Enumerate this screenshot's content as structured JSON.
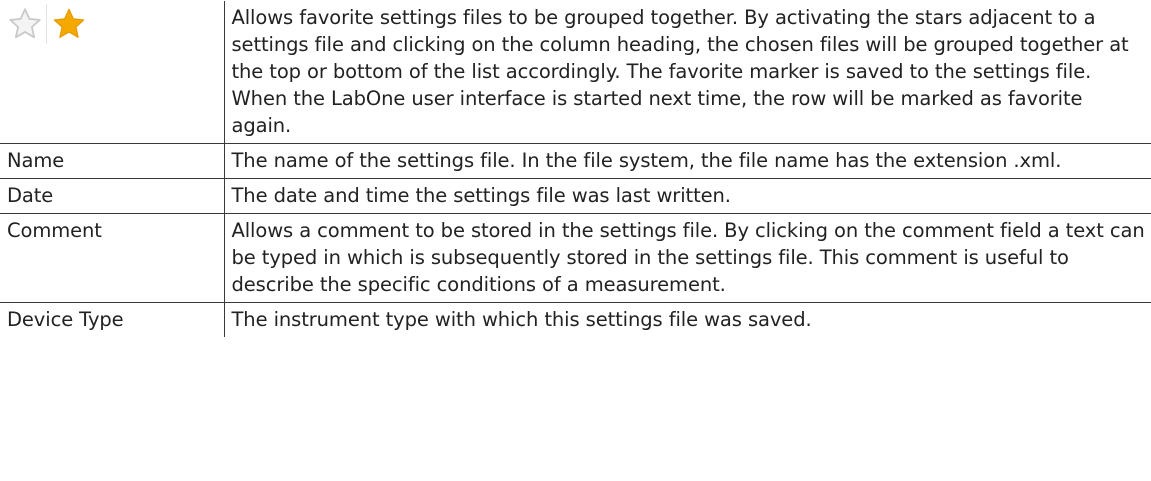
{
  "rows": [
    {
      "icons": [
        {
          "name": "star-outline-icon",
          "color": "#c9c9c9"
        },
        {
          "name": "star-filled-icon",
          "color": "#f5a800"
        }
      ],
      "desc": "Allows favorite settings files to be grouped together. By activating the stars adjacent to a settings file and clicking on the column heading, the chosen files will be grouped together at the top or bottom of the list accordingly. The favorite marker is saved to the settings file. When the LabOne user interface is started next time, the row will be marked as favorite again."
    },
    {
      "term": "Name",
      "desc": "The name of the settings file. In the file system, the file name has the extension .xml."
    },
    {
      "term": "Date",
      "desc": "The date and time the settings file was last written."
    },
    {
      "term": "Comment",
      "desc": "Allows a comment to be stored in the settings file. By clicking on the comment field a text can be typed in which is subsequently stored in the settings file. This comment is useful to describe the specific conditions of a measurement."
    },
    {
      "term": "Device Type",
      "desc": "The instrument type with which this settings file was saved."
    }
  ]
}
